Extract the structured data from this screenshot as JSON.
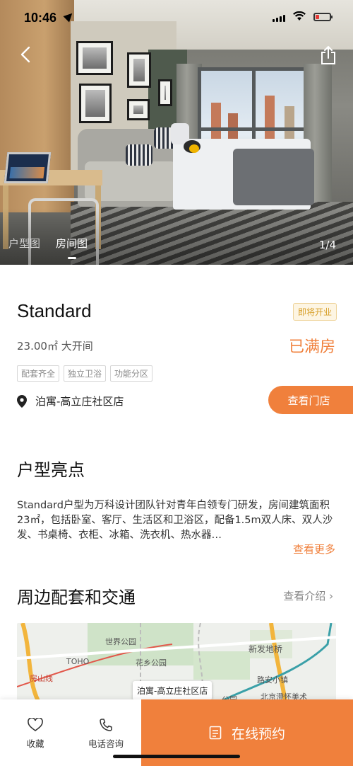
{
  "status_bar": {
    "time": "10:46"
  },
  "gallery": {
    "tabs": [
      "户型图",
      "房间图"
    ],
    "active_tab": "房间图",
    "counter": "1/4"
  },
  "room": {
    "title": "Standard",
    "badge": "即将开业",
    "area": "23.00㎡ 大开间",
    "availability": "已满房",
    "tags": [
      "配套齐全",
      "独立卫浴",
      "功能分区"
    ],
    "store_name": "泊寓-高立庄社区店",
    "view_store_label": "查看门店"
  },
  "highlights": {
    "heading": "户型亮点",
    "description": "Standard户型为万科设计团队针对青年白领专门研发，房间建筑面积23㎡，包括卧室、客厅、生活区和卫浴区，配备1.5m双人床、双人沙发、书桌椅、衣柜、冰箱、洗衣机、热水器…",
    "more_label": "查看更多"
  },
  "surroundings": {
    "heading": "周边配套和交通",
    "intro_label": "查看介绍",
    "map_labels": {
      "park1": "世界公园",
      "toho": "TOHO",
      "park2": "花乡公园",
      "metro": "房山线",
      "bridge": "新发地桥",
      "town": "路安小镇",
      "art": "北京澄怀美术",
      "callout": "泊寓-高立庄社区店",
      "other": "公园"
    }
  },
  "bottom_bar": {
    "favorite_label": "收藏",
    "phone_label": "电话咨询",
    "book_label": "在线预约"
  },
  "colors": {
    "accent": "#f0803c",
    "badge": "#d8a02b"
  }
}
